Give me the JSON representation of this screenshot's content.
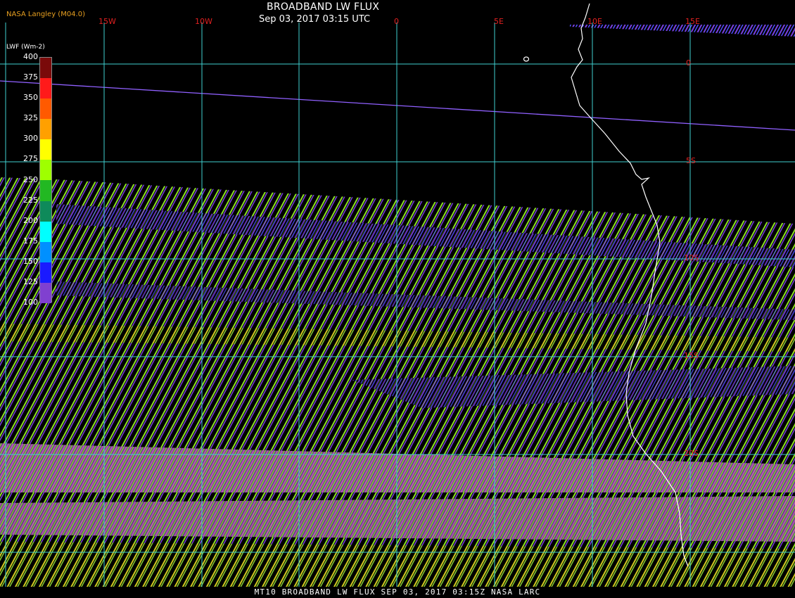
{
  "header": {
    "org": "NASA Langley (M04.0)",
    "title": "BROADBAND LW FLUX",
    "subtitle": "Sep 03, 2017 03:15 UTC"
  },
  "legend": {
    "title": "LWF (Wm-2)",
    "ticks": [
      "400",
      "375",
      "350",
      "325",
      "300",
      "275",
      "250",
      "225",
      "200",
      "175",
      "150",
      "125",
      "100"
    ],
    "colors": [
      "#7a0a0a",
      "#ff1a1a",
      "#ff5a00",
      "#ffa000",
      "#ffff00",
      "#9fff00",
      "#22b822",
      "#0e8a5a",
      "#00ffff",
      "#0090ff",
      "#1a1aff",
      "#8040d0"
    ]
  },
  "grid": {
    "lon_labels": [
      "15W",
      "10W",
      "0",
      "5E",
      "10E",
      "15E"
    ],
    "lat_labels": [
      "0",
      "5S",
      "10S",
      "15S",
      "20S"
    ]
  },
  "footer": {
    "text": "MT10  BROADBAND LW FLUX  SEP 03, 2017 03:15Z  NASA LARC"
  },
  "colors": {
    "grid": "#40d0d0",
    "label": "#e02020",
    "coast": "#ffffff",
    "orbit_line": "#9060ff",
    "stripe_green": "#8ae020",
    "stripe_yellow": "#d8c820",
    "stripe_purple": "#7a40e0",
    "stripe_magenta": "#c060b0",
    "stripe_blue": "#5050ff"
  }
}
